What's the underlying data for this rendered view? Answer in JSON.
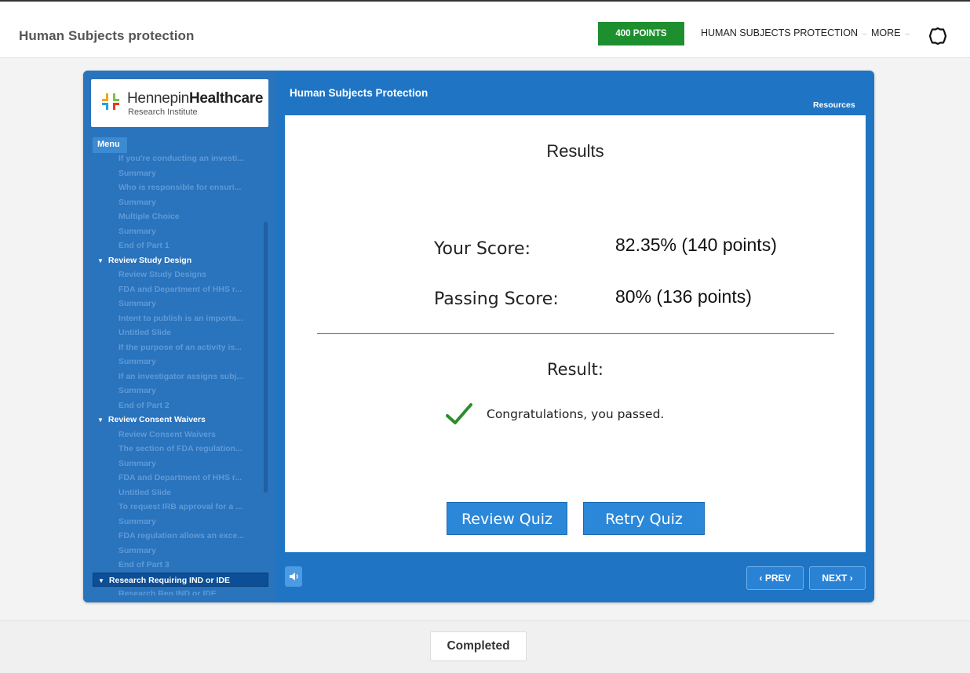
{
  "header": {
    "app_title": "Human Subjects protection",
    "points_badge": "400 POINTS",
    "nav_course": "HUMAN SUBJECTS PROTECTION",
    "nav_more": "MORE",
    "caret": "–"
  },
  "logo": {
    "name_regular": "Hennepin",
    "name_bold": "Healthcare",
    "subtitle": "Research Institute"
  },
  "sidebar": {
    "menu_tab": "Menu",
    "items": [
      {
        "label": "If you're conducting an investi...",
        "type": "sub"
      },
      {
        "label": "Summary",
        "type": "sub"
      },
      {
        "label": "Who is responsible for ensuri...",
        "type": "sub"
      },
      {
        "label": "Summary",
        "type": "sub"
      },
      {
        "label": "Multiple Choice",
        "type": "sub"
      },
      {
        "label": "Summary",
        "type": "sub"
      },
      {
        "label": "End of Part 1",
        "type": "sub"
      },
      {
        "label": "Review Study Design",
        "type": "section"
      },
      {
        "label": "Review Study Designs",
        "type": "sub"
      },
      {
        "label": "FDA and Department of HHS r...",
        "type": "sub"
      },
      {
        "label": "Summary",
        "type": "sub"
      },
      {
        "label": "Intent to publish is an importa...",
        "type": "sub"
      },
      {
        "label": "Untitled Slide",
        "type": "sub"
      },
      {
        "label": "If the purpose of an activity is...",
        "type": "sub"
      },
      {
        "label": "Summary",
        "type": "sub"
      },
      {
        "label": "If an investigator assigns subj...",
        "type": "sub"
      },
      {
        "label": "Summary",
        "type": "sub"
      },
      {
        "label": "End of Part 2",
        "type": "sub"
      },
      {
        "label": "Review Consent Waivers",
        "type": "section"
      },
      {
        "label": "Review Consent Waivers",
        "type": "sub"
      },
      {
        "label": "The section of FDA regulation...",
        "type": "sub"
      },
      {
        "label": "Summary",
        "type": "sub"
      },
      {
        "label": "FDA and Department of HHS r...",
        "type": "sub"
      },
      {
        "label": "Untitled Slide",
        "type": "sub"
      },
      {
        "label": "To request IRB approval for a ...",
        "type": "sub"
      },
      {
        "label": "Summary",
        "type": "sub"
      },
      {
        "label": "FDA regulation allows an exce...",
        "type": "sub"
      },
      {
        "label": "Summary",
        "type": "sub"
      },
      {
        "label": "End of Part 3",
        "type": "sub"
      },
      {
        "label": "Research Requiring IND or IDE",
        "type": "section",
        "active": true
      },
      {
        "label": "Research Req IND or IDE",
        "type": "sub"
      }
    ]
  },
  "player": {
    "course_title": "Human Subjects Protection",
    "resources": "Resources",
    "prev": "‹ PREV",
    "next": "NEXT ›"
  },
  "results": {
    "title": "Results",
    "your_score_label": "Your Score:",
    "your_score_value": "82.35% (140 points)",
    "passing_score_label": "Passing Score:",
    "passing_score_value": "80% (136 points)",
    "result_label": "Result:",
    "message": "Congratulations, you passed.",
    "review_button": "Review Quiz",
    "retry_button": "Retry Quiz"
  },
  "footer": {
    "completed": "Completed"
  },
  "colors": {
    "badge_green": "#1e8f2f",
    "player_blue": "#1f75c4",
    "button_blue": "#2b87d8",
    "check_green": "#2e8b2e"
  }
}
